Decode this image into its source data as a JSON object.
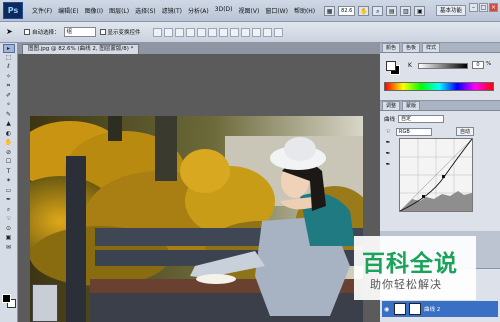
{
  "app": {
    "logo": "Ps"
  },
  "menubar": {
    "items": [
      "文件(F)",
      "编辑(E)",
      "图像(I)",
      "图层(L)",
      "选择(S)",
      "滤镜(T)",
      "分析(A)",
      "3D(D)",
      "视图(V)",
      "窗口(W)",
      "帮助(H)"
    ],
    "zoom": "82.6",
    "workspace": "基本功能",
    "window_min": "–",
    "window_max": "□",
    "window_close": "×"
  },
  "options": {
    "auto_select": "自动选择：",
    "auto_select_value": "组",
    "show_transform": "显示变换控件"
  },
  "document": {
    "tab_title": "图图.jpg @ 82.6% (曲线 2, 图层蒙版/8) *"
  },
  "tools": [
    "▸",
    "⬚",
    "ℓ",
    "✧",
    "⌗",
    "✐",
    "⚬",
    "✎",
    "▲",
    "◐",
    "✋",
    "⊘",
    "☐",
    "T",
    "✶",
    "▭",
    "✒",
    "⌕",
    "☜",
    "⊙",
    "▣",
    "✉"
  ],
  "color_panel": {
    "tabs": [
      "颜色",
      "色板",
      "样式"
    ],
    "channel_label": "K",
    "k_value": "0",
    "percent": "%"
  },
  "adjustments": {
    "tabs": [
      "调整",
      "蒙版"
    ],
    "type_label": "曲线",
    "preset": "自定",
    "channel": "RGB",
    "auto_label": "自动"
  },
  "layers": {
    "layer_name": "曲线 2"
  },
  "watermark": {
    "title": "百科全说",
    "subtitle": "助你轻松解决"
  }
}
